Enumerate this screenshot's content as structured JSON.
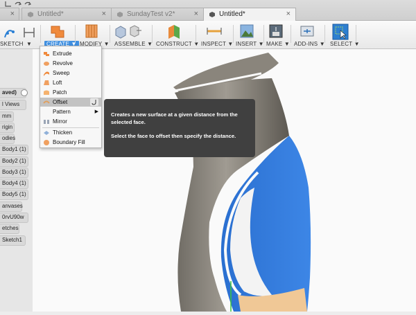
{
  "tabs": [
    {
      "label": "Untitled*",
      "active": false
    },
    {
      "label": "SundayTest v2*",
      "active": false
    },
    {
      "label": "Untitled*",
      "active": true
    }
  ],
  "toolbar": {
    "sketch": "SKETCH",
    "create": "CREATE",
    "modify": "MODIFY",
    "assemble": "ASSEMBLE",
    "construct": "CONSTRUCT",
    "inspect": "INSPECT",
    "insert": "INSERT",
    "make": "MAKE",
    "addins": "ADD-INS",
    "select": "SELECT"
  },
  "browser": {
    "items": [
      "aved)",
      "l Views",
      "mm",
      "rigin",
      "odies",
      "Body1 (1)",
      "Body2 (1)",
      "Body3 (1)",
      "Body4 (1)",
      "Body5 (1)",
      "anvases",
      "0rvU90w",
      "etches",
      "Sketch1"
    ]
  },
  "create_menu": {
    "items": [
      {
        "label": "Extrude",
        "icon": "extrude-icon"
      },
      {
        "label": "Revolve",
        "icon": "revolve-icon"
      },
      {
        "label": "Sweep",
        "icon": "sweep-icon"
      },
      {
        "label": "Loft",
        "icon": "loft-icon"
      },
      {
        "label": "Patch",
        "icon": "patch-icon"
      },
      {
        "label": "Offset",
        "icon": "offset-icon"
      },
      {
        "label": "Pattern",
        "icon": ""
      },
      {
        "label": "Mirror",
        "icon": "mirror-icon"
      },
      {
        "label": "Thicken",
        "icon": "thicken-icon"
      },
      {
        "label": "Boundary Fill",
        "icon": "boundary-fill-icon"
      }
    ],
    "highlighted": "Offset"
  },
  "tooltip": {
    "line1": "Creates a new surface at a given distance from the selected face.",
    "line2": "Select the face to offset then specify the distance."
  },
  "colors": {
    "accent": "#3f8fe0",
    "face_blue": "#2f78d8",
    "body_gray": "#8a857c",
    "tooltip_bg": "#404040"
  }
}
